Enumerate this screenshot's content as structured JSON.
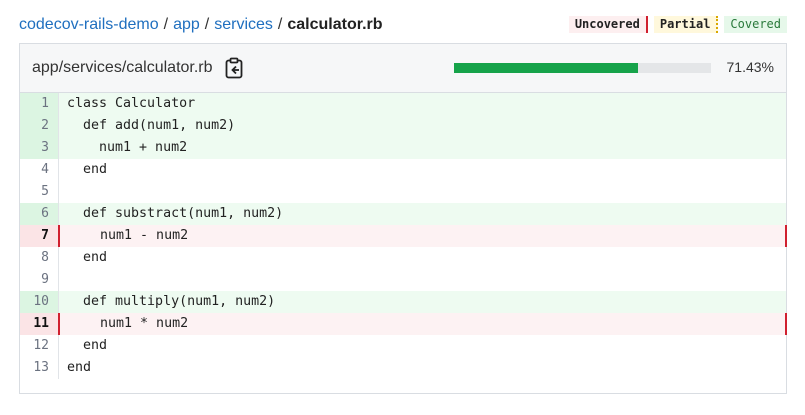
{
  "breadcrumb": {
    "parts": [
      "codecov-rails-demo",
      "app",
      "services"
    ],
    "separator": "/",
    "current": "calculator.rb"
  },
  "legend": {
    "uncovered": "Uncovered",
    "partial": "Partial",
    "covered": "Covered"
  },
  "file": {
    "path": "app/services/calculator.rb",
    "coverage_percent": 71.43,
    "coverage_label": "71.43%"
  },
  "colors": {
    "covered": "#16a34a",
    "uncovered": "#d0202f",
    "partial": "#d9a800",
    "link": "#1f6fbf"
  },
  "lines": [
    {
      "n": "1",
      "code": "class Calculator",
      "status": "covered"
    },
    {
      "n": "2",
      "code": "  def add(num1, num2)",
      "status": "covered"
    },
    {
      "n": "3",
      "code": "    num1 + num2",
      "status": "covered"
    },
    {
      "n": "4",
      "code": "  end",
      "status": "none"
    },
    {
      "n": "5",
      "code": "",
      "status": "none"
    },
    {
      "n": "6",
      "code": "  def substract(num1, num2)",
      "status": "covered"
    },
    {
      "n": "7",
      "code": "    num1 - num2",
      "status": "uncovered"
    },
    {
      "n": "8",
      "code": "  end",
      "status": "none"
    },
    {
      "n": "9",
      "code": "",
      "status": "none"
    },
    {
      "n": "10",
      "code": "  def multiply(num1, num2)",
      "status": "covered"
    },
    {
      "n": "11",
      "code": "    num1 * num2",
      "status": "uncovered"
    },
    {
      "n": "12",
      "code": "  end",
      "status": "none"
    },
    {
      "n": "13",
      "code": "end",
      "status": "none"
    }
  ]
}
